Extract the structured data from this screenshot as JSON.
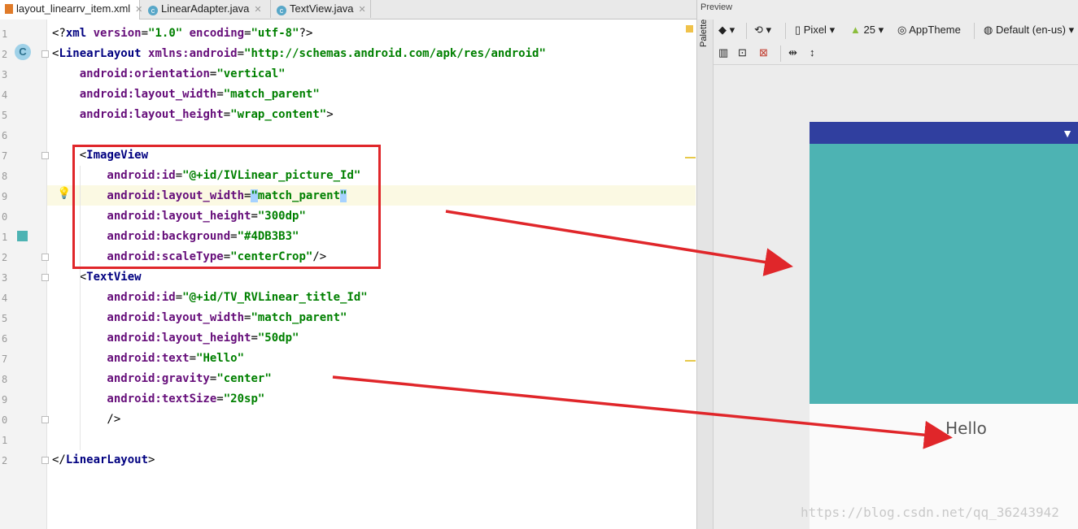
{
  "tabs": [
    {
      "label": "layout_linearrv_item.xml",
      "type": "xml",
      "active": true
    },
    {
      "label": "LinearAdapter.java",
      "type": "java",
      "active": false
    },
    {
      "label": "TextView.java",
      "type": "java",
      "active": false
    }
  ],
  "editor": {
    "line_numbers": [
      "1",
      "2",
      "3",
      "4",
      "5",
      "6",
      "7",
      "8",
      "9",
      "0",
      "1",
      "2",
      "3",
      "4",
      "5",
      "6",
      "7",
      "8",
      "9",
      "0",
      "1",
      "2"
    ],
    "lines": [
      [
        {
          "t": "<?",
          "c": "pl"
        },
        {
          "t": "xml ",
          "c": "tag"
        },
        {
          "t": "version",
          "c": "attr"
        },
        {
          "t": "=",
          "c": "pl"
        },
        {
          "t": "\"1.0\"",
          "c": "val"
        },
        {
          "t": " ",
          "c": "pl"
        },
        {
          "t": "encoding",
          "c": "attr"
        },
        {
          "t": "=",
          "c": "pl"
        },
        {
          "t": "\"utf-8\"",
          "c": "val"
        },
        {
          "t": "?>",
          "c": "pl"
        }
      ],
      [
        {
          "t": "<",
          "c": "pl"
        },
        {
          "t": "LinearLayout ",
          "c": "tag"
        },
        {
          "t": "xmlns:android",
          "c": "attr"
        },
        {
          "t": "=",
          "c": "pl"
        },
        {
          "t": "\"http://schemas.android.com/apk/res/android\"",
          "c": "val"
        }
      ],
      [
        {
          "t": "    android:",
          "c": "ns"
        },
        {
          "t": "orientation",
          "c": "attr"
        },
        {
          "t": "=",
          "c": "pl"
        },
        {
          "t": "\"vertical\"",
          "c": "val"
        }
      ],
      [
        {
          "t": "    android:",
          "c": "ns"
        },
        {
          "t": "layout_width",
          "c": "attr"
        },
        {
          "t": "=",
          "c": "pl"
        },
        {
          "t": "\"match_parent\"",
          "c": "val"
        }
      ],
      [
        {
          "t": "    android:",
          "c": "ns"
        },
        {
          "t": "layout_height",
          "c": "attr"
        },
        {
          "t": "=",
          "c": "pl"
        },
        {
          "t": "\"wrap_content\"",
          "c": "val"
        },
        {
          "t": ">",
          "c": "pl"
        }
      ],
      [],
      [
        {
          "t": "    <",
          "c": "pl"
        },
        {
          "t": "ImageView",
          "c": "tag"
        }
      ],
      [
        {
          "t": "        android:",
          "c": "ns"
        },
        {
          "t": "id",
          "c": "attr"
        },
        {
          "t": "=",
          "c": "pl"
        },
        {
          "t": "\"@+id/IVLinear_picture_Id\"",
          "c": "val"
        }
      ],
      [
        {
          "t": "        android:",
          "c": "ns"
        },
        {
          "t": "layout_width",
          "c": "attr"
        },
        {
          "t": "=",
          "c": "pl"
        },
        {
          "t": "\"",
          "c": "val selq"
        },
        {
          "t": "match_parent",
          "c": "val"
        },
        {
          "t": "\"",
          "c": "val selq"
        }
      ],
      [
        {
          "t": "        android:",
          "c": "ns"
        },
        {
          "t": "layout_height",
          "c": "attr"
        },
        {
          "t": "=",
          "c": "pl"
        },
        {
          "t": "\"300dp\"",
          "c": "val"
        }
      ],
      [
        {
          "t": "        android:",
          "c": "ns"
        },
        {
          "t": "background",
          "c": "attr"
        },
        {
          "t": "=",
          "c": "pl"
        },
        {
          "t": "\"#4DB3B3\"",
          "c": "val"
        }
      ],
      [
        {
          "t": "        android:",
          "c": "ns"
        },
        {
          "t": "scaleType",
          "c": "attr"
        },
        {
          "t": "=",
          "c": "pl"
        },
        {
          "t": "\"centerCrop\"",
          "c": "val"
        },
        {
          "t": "/>",
          "c": "pl"
        }
      ],
      [
        {
          "t": "    <",
          "c": "pl"
        },
        {
          "t": "TextView",
          "c": "tag"
        }
      ],
      [
        {
          "t": "        android:",
          "c": "ns"
        },
        {
          "t": "id",
          "c": "attr"
        },
        {
          "t": "=",
          "c": "pl"
        },
        {
          "t": "\"@+id/TV_RVLinear_title_Id\"",
          "c": "val"
        }
      ],
      [
        {
          "t": "        android:",
          "c": "ns"
        },
        {
          "t": "layout_width",
          "c": "attr"
        },
        {
          "t": "=",
          "c": "pl"
        },
        {
          "t": "\"match_parent\"",
          "c": "val"
        }
      ],
      [
        {
          "t": "        android:",
          "c": "ns"
        },
        {
          "t": "layout_height",
          "c": "attr"
        },
        {
          "t": "=",
          "c": "pl"
        },
        {
          "t": "\"50dp\"",
          "c": "val"
        }
      ],
      [
        {
          "t": "        android:",
          "c": "ns"
        },
        {
          "t": "text",
          "c": "attr"
        },
        {
          "t": "=",
          "c": "pl"
        },
        {
          "t": "\"Hello\"",
          "c": "val"
        }
      ],
      [
        {
          "t": "        android:",
          "c": "ns"
        },
        {
          "t": "gravity",
          "c": "attr"
        },
        {
          "t": "=",
          "c": "pl"
        },
        {
          "t": "\"center\"",
          "c": "val"
        }
      ],
      [
        {
          "t": "        android:",
          "c": "ns"
        },
        {
          "t": "textSize",
          "c": "attr"
        },
        {
          "t": "=",
          "c": "pl"
        },
        {
          "t": "\"20sp\"",
          "c": "val"
        }
      ],
      [
        {
          "t": "        />",
          "c": "pl"
        }
      ],
      [],
      [
        {
          "t": "</",
          "c": "pl"
        },
        {
          "t": "LinearLayout",
          "c": "tag"
        },
        {
          "t": ">",
          "c": "pl"
        }
      ]
    ],
    "class_badge": "C"
  },
  "preview": {
    "title": "Preview",
    "palette_label": "Palette",
    "device": "Pixel",
    "api_level": "25",
    "theme": "AppTheme",
    "locale": "Default (en-us)",
    "imageview_color": "#4DB3B3",
    "statusbar_color": "#303F9F",
    "hello_text": "Hello"
  },
  "watermark": "https://blog.csdn.net/qq_36243942"
}
